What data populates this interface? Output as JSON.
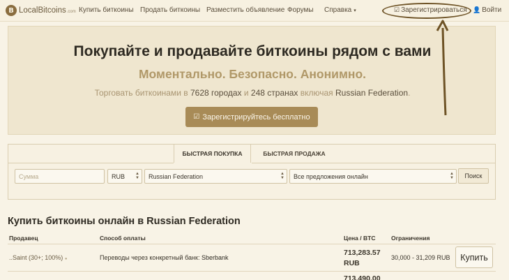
{
  "nav": {
    "logo_text": "LocalBitcoins",
    "logo_domain": ".com",
    "logo_glyph": "B",
    "links": [
      "Купить биткоины",
      "Продать биткоины",
      "Разместить объявление",
      "Форумы",
      "Справка"
    ],
    "help_caret": "▾",
    "register_label": "Зарегистрироваться",
    "login_label": "Войти"
  },
  "hero": {
    "title": "Покупайте и продавайте биткоины рядом с вами",
    "subtitle": "Моментально. Безопасно. Анонимно.",
    "line_part1": "Торговать биткоинами в ",
    "cities": "7628 городах",
    "line_part2": " и ",
    "countries": "248 странах",
    "line_part3": " включая ",
    "country": "Russian Federation",
    "line_end": ".",
    "cta_label": "Зарегистрируйтесь бесплатно"
  },
  "search": {
    "tab_buy": "БЫСТРАЯ ПОКУПКА",
    "tab_sell": "БЫСТРАЯ ПРОДАЖА",
    "amount_placeholder": "Сумма",
    "currency": "RUB",
    "country": "Russian Federation",
    "offers": "Все предложения онлайн",
    "search_label": "Поиск"
  },
  "listing": {
    "title": "Купить биткоины онлайн в Russian Federation",
    "columns": {
      "seller": "Продавец",
      "payment": "Способ оплаты",
      "price": "Цена / BTC",
      "limits": "Ограничения"
    },
    "rows": [
      {
        "seller": "..Saint (30+; 100%)",
        "payment_prefix": "Переводы через конкретный банк: ",
        "payment_bank": "Sberbank",
        "price": "713,283.57",
        "currency": "RUB",
        "limits": "30,000 - 31,209 RUB",
        "action": "Купить"
      },
      {
        "price": "713,490.00"
      }
    ]
  },
  "colors": {
    "accent": "#a88b57",
    "annotation": "#6e5326"
  }
}
